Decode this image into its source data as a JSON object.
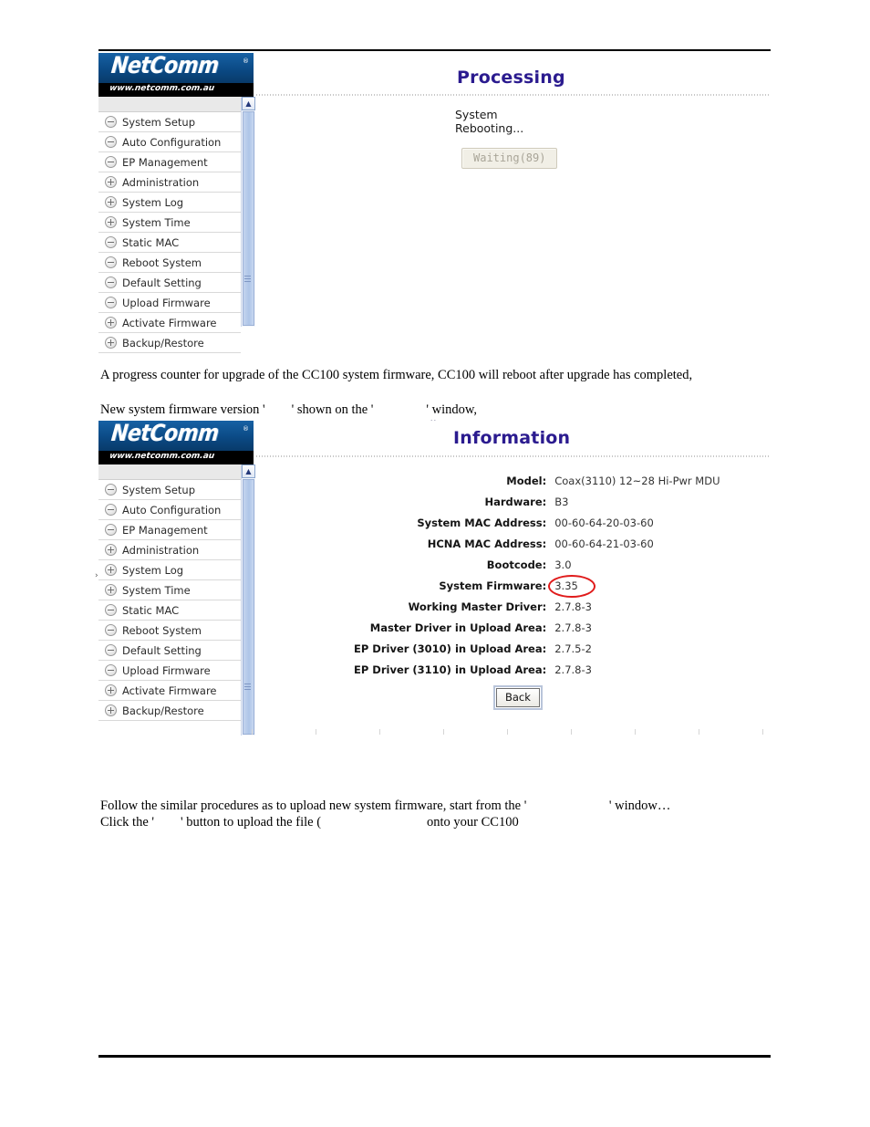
{
  "document": {
    "paragraph_1": "A progress counter for upgrade of the CC100 system firmware, CC100 will reboot after upgrade has completed,",
    "paragraph_2": "New system firmware version '        ' shown on the '                ' window,",
    "paragraph_3": "Follow the similar procedures as to upload new system firmware, start from the '                         ' window…",
    "paragraph_4": "Click the '        ' button to upload the file (                                onto your CC100"
  },
  "logo": {
    "wordmark": "NetComm",
    "registered": "®",
    "url": "www.netcomm.com.au"
  },
  "sidebar": {
    "items": [
      {
        "label": "System Setup",
        "icon": "minus-circle-icon",
        "state": "expanded"
      },
      {
        "label": "Auto Configuration",
        "icon": "minus-circle-icon",
        "state": "expanded"
      },
      {
        "label": "EP Management",
        "icon": "minus-circle-icon",
        "state": "expanded"
      },
      {
        "label": "Administration",
        "icon": "plus-circle-icon",
        "state": "collapsed"
      },
      {
        "label": "System Log",
        "icon": "plus-circle-icon",
        "state": "collapsed"
      },
      {
        "label": "System Time",
        "icon": "plus-circle-icon",
        "state": "collapsed"
      },
      {
        "label": "Static MAC",
        "icon": "minus-circle-icon",
        "state": "expanded"
      },
      {
        "label": "Reboot System",
        "icon": "minus-circle-icon",
        "state": "expanded"
      },
      {
        "label": "Default Setting",
        "icon": "minus-circle-icon",
        "state": "expanded"
      },
      {
        "label": "Upload Firmware",
        "icon": "minus-circle-icon",
        "state": "expanded"
      },
      {
        "label": "Activate Firmware",
        "icon": "plus-circle-icon",
        "state": "collapsed"
      },
      {
        "label": "Backup/Restore",
        "icon": "plus-circle-icon",
        "state": "collapsed"
      }
    ],
    "scroll_up_glyph": "▲"
  },
  "processing_panel": {
    "title": "Processing",
    "status": "System Rebooting...",
    "wait_button": "Waiting(89)"
  },
  "information_panel": {
    "title": "Information",
    "rows": [
      {
        "label": "Model:",
        "value": "Coax(3110) 12~28 Hi-Pwr MDU"
      },
      {
        "label": "Hardware:",
        "value": "B3"
      },
      {
        "label": "System MAC Address:",
        "value": "00-60-64-20-03-60"
      },
      {
        "label": "HCNA MAC Address:",
        "value": "00-60-64-21-03-60"
      },
      {
        "label": "Bootcode:",
        "value": "3.0"
      },
      {
        "label": "System Firmware:",
        "value": "3.35"
      },
      {
        "label": "Working Master Driver:",
        "value": "2.7.8-3"
      },
      {
        "label": "Master Driver in Upload Area:",
        "value": "2.7.8-3"
      },
      {
        "label": "EP Driver (3010) in Upload Area:",
        "value": "2.7.5-2"
      },
      {
        "label": "EP Driver (3110) in Upload Area:",
        "value": "2.7.8-3"
      }
    ],
    "highlighted_row_index": 5,
    "back_button": "Back"
  },
  "colors": {
    "title_purple": "#2b1b8f",
    "logo_blue": "#0a4d8c",
    "annotation_red": "#e01b1b",
    "scrollbar_blue": "#aec5e8"
  },
  "artifacts": {
    "chevron": "⌄",
    "left_marker": "›"
  }
}
